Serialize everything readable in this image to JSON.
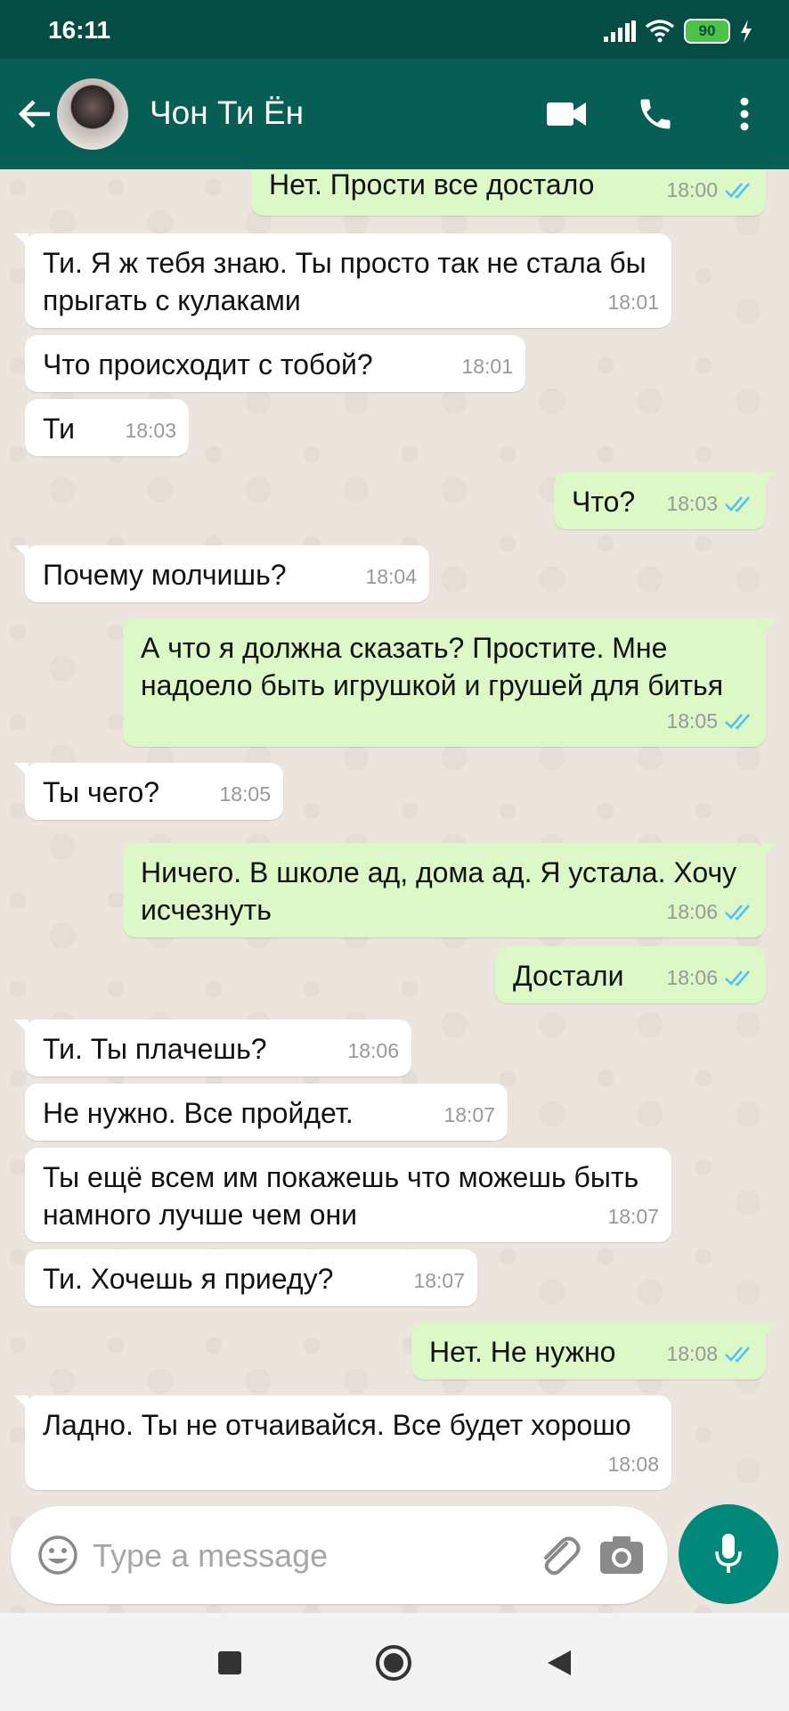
{
  "status_bar": {
    "time": "16:11",
    "battery": "90"
  },
  "header": {
    "contact_name": "Чон Ти Ён"
  },
  "messages": [
    {
      "dir": "out",
      "text": "Нет. Прости все достало",
      "time": "18:00"
    },
    {
      "dir": "in",
      "text": "Ти. Я ж тебя знаю. Ты просто так не стала бы прыгать с кулаками",
      "time": "18:01"
    },
    {
      "dir": "in",
      "text": "Что происходит с тобой?",
      "time": "18:01"
    },
    {
      "dir": "in",
      "text": "Ти",
      "time": "18:03"
    },
    {
      "dir": "out",
      "text": "Что?",
      "time": "18:03"
    },
    {
      "dir": "in",
      "text": "Почему молчишь?",
      "time": "18:04"
    },
    {
      "dir": "out",
      "text": "А что я должна сказать? Простите. Мне надоело быть игрушкой и грушей для битья",
      "time": "18:05"
    },
    {
      "dir": "in",
      "text": "Ты чего?",
      "time": "18:05"
    },
    {
      "dir": "out",
      "text": "Ничего. В школе ад, дома ад. Я устала. Хочу исчезнуть",
      "time": "18:06"
    },
    {
      "dir": "out",
      "text": "Достали",
      "time": "18:06"
    },
    {
      "dir": "in",
      "text": "Ти.  Ты плачешь?",
      "time": "18:06"
    },
    {
      "dir": "in",
      "text": "Не нужно. Все пройдет.",
      "time": "18:07"
    },
    {
      "dir": "in",
      "text": "Ты ещё всем им покажешь что можешь быть намного лучше чем они",
      "time": "18:07"
    },
    {
      "dir": "in",
      "text": "Ти. Хочешь я приеду?",
      "time": "18:07"
    },
    {
      "dir": "out",
      "text": "Нет. Не нужно",
      "time": "18:08"
    },
    {
      "dir": "in",
      "text": "Ладно. Ты не отчаивайся. Все будет хорошо",
      "time": "18:08"
    }
  ],
  "composer": {
    "placeholder": "Type a message"
  },
  "colors": {
    "header": "#075e54",
    "status_bar": "#054d44",
    "outgoing_bubble": "#dcf8c6",
    "incoming_bubble": "#ffffff",
    "read_tick": "#4fc3f7",
    "mic_button": "#00897b"
  }
}
